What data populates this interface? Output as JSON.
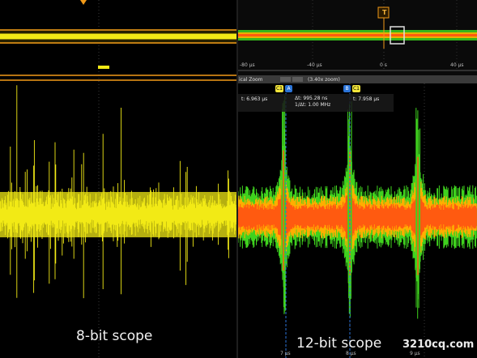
{
  "left": {
    "caption": "8-bit scope",
    "trace_color": "#f2ea16"
  },
  "right": {
    "caption": "12-bit scope",
    "trigger_marker": "T",
    "overview_ticks": [
      "-80 µs",
      "-40 µs",
      "0 s",
      "40 µs"
    ],
    "zoom_label": "ical Zoom",
    "zoom_factor": "(3.40x zoom)",
    "cursor_a": {
      "tag": "C1",
      "marker": "A",
      "readout": "t:  6.963 µs"
    },
    "cursor_b": {
      "tag": "C1",
      "marker": "B",
      "readout": "t:  7.958 µs"
    },
    "delta_t": "Δt:  995.28 ns",
    "inv_delta_t": "1/Δt:  1.00 MHz",
    "bottom_ticks": [
      "7 µs",
      "8 µs",
      "9 µs"
    ],
    "colors": {
      "core": "#ff5a10",
      "mid": "#ffae00",
      "outer": "#3fd21e",
      "cursor": "#2b74d8",
      "tag": "#f2e53a"
    }
  },
  "watermark": "3210cq.com"
}
